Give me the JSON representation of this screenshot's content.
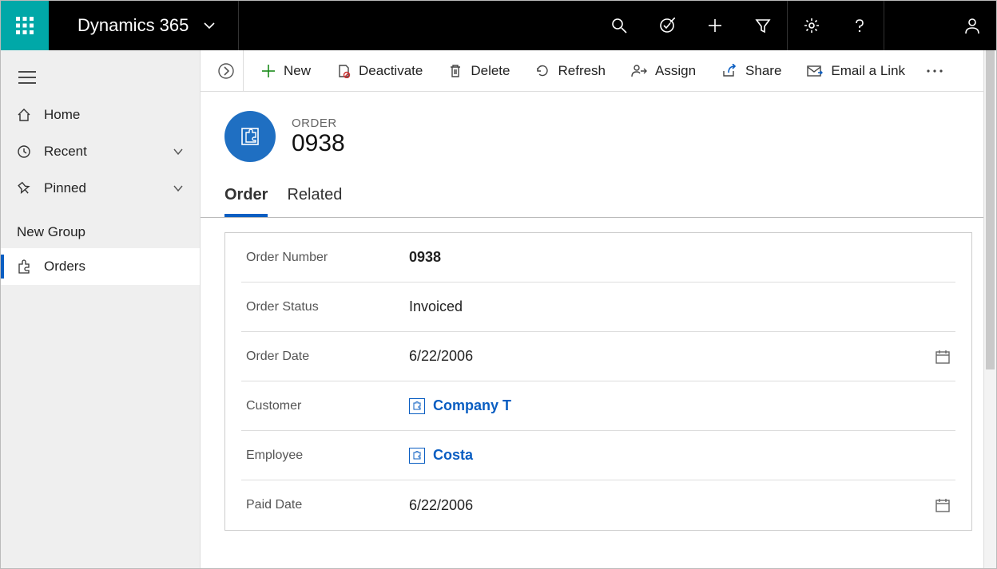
{
  "topbar": {
    "brand": "Dynamics 365"
  },
  "sidebar": {
    "home": "Home",
    "recent": "Recent",
    "pinned": "Pinned",
    "group_label": "New Group",
    "orders": "Orders"
  },
  "commands": {
    "new": "New",
    "deactivate": "Deactivate",
    "delete": "Delete",
    "refresh": "Refresh",
    "assign": "Assign",
    "share": "Share",
    "email_link": "Email a Link"
  },
  "header": {
    "entity_type": "ORDER",
    "entity_name": "0938"
  },
  "tabs": {
    "order": "Order",
    "related": "Related"
  },
  "form": {
    "order_number": {
      "label": "Order Number",
      "value": "0938"
    },
    "order_status": {
      "label": "Order Status",
      "value": "Invoiced"
    },
    "order_date": {
      "label": "Order Date",
      "value": "6/22/2006"
    },
    "customer": {
      "label": "Customer",
      "value": "Company T"
    },
    "employee": {
      "label": "Employee",
      "value": "Costa"
    },
    "paid_date": {
      "label": "Paid Date",
      "value": "6/22/2006"
    }
  }
}
